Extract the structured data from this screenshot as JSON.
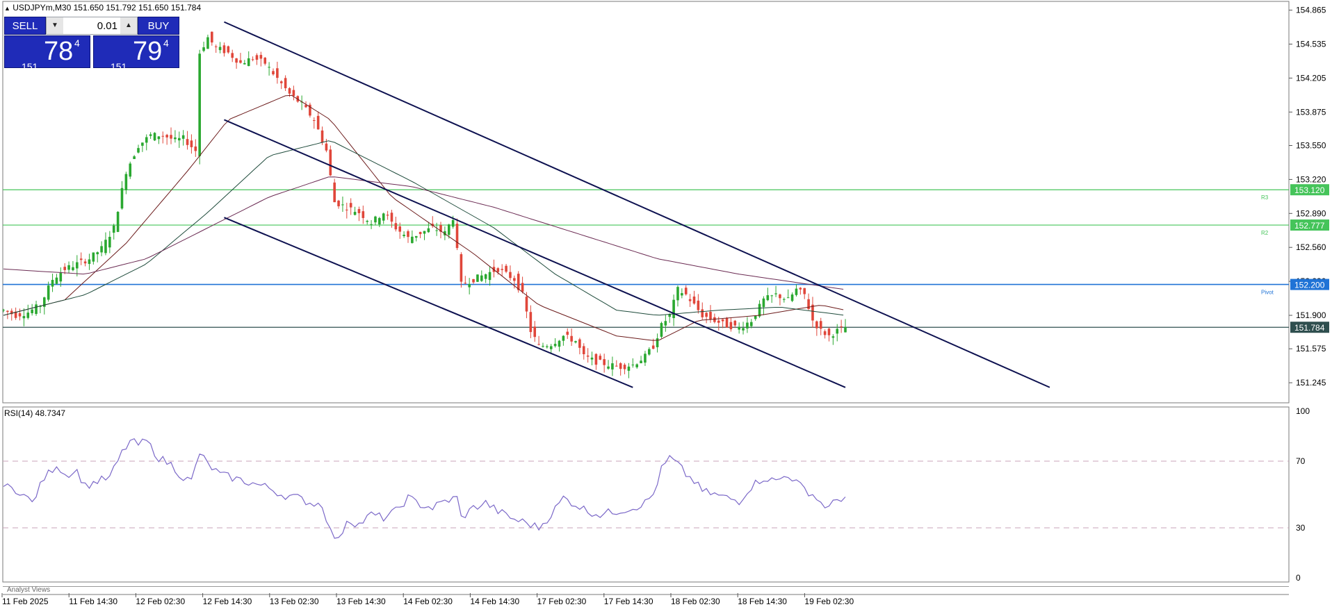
{
  "header": {
    "symbol_info": "USDJPYm,M30  151.650 151.792 151.650 151.784"
  },
  "trade_panel": {
    "sell_label": "SELL",
    "buy_label": "BUY",
    "lot": "0.01",
    "sell_price": {
      "big": "151",
      "main": "78",
      "sup": "4"
    },
    "buy_price": {
      "big": "151",
      "main": "79",
      "sup": "4"
    },
    "colors": {
      "button": "#1f2bb8"
    }
  },
  "bottom_tab": {
    "label": "Analyst Views"
  },
  "chart_data": [
    {
      "type": "candlestick",
      "title": "USDJPYm,M30",
      "ylim": [
        151.05,
        154.95
      ],
      "y_ticks": [
        "154.865",
        "154.535",
        "154.205",
        "153.875",
        "153.550",
        "153.220",
        "152.890",
        "152.560",
        "152.230",
        "151.900",
        "151.575",
        "151.245"
      ],
      "x_ticks": [
        "11 Feb 2025",
        "11 Feb 14:30",
        "12 Feb 02:30",
        "12 Feb 14:30",
        "13 Feb 02:30",
        "13 Feb 14:30",
        "14 Feb 02:30",
        "14 Feb 14:30",
        "17 Feb 02:30",
        "17 Feb 14:30",
        "18 Feb 02:30",
        "18 Feb 14:30",
        "19 Feb 02:30"
      ],
      "close_path": [
        [
          0,
          151.95
        ],
        [
          6,
          151.9
        ],
        [
          12,
          151.93
        ],
        [
          18,
          152.0
        ],
        [
          24,
          152.25
        ],
        [
          30,
          152.35
        ],
        [
          36,
          152.4
        ],
        [
          42,
          152.45
        ],
        [
          48,
          152.55
        ],
        [
          54,
          152.75
        ],
        [
          60,
          153.3
        ],
        [
          66,
          153.55
        ],
        [
          72,
          153.65
        ],
        [
          78,
          153.65
        ],
        [
          84,
          153.6
        ],
        [
          88,
          153.62
        ],
        [
          94,
          153.5
        ],
        [
          96,
          154.45
        ],
        [
          100,
          154.6
        ],
        [
          104,
          154.5
        ],
        [
          110,
          154.45
        ],
        [
          116,
          154.35
        ],
        [
          122,
          154.4
        ],
        [
          128,
          154.35
        ],
        [
          134,
          154.2
        ],
        [
          140,
          154.05
        ],
        [
          146,
          153.95
        ],
        [
          152,
          153.8
        ],
        [
          158,
          153.5
        ],
        [
          162,
          153.0
        ],
        [
          168,
          152.95
        ],
        [
          174,
          152.9
        ],
        [
          180,
          152.8
        ],
        [
          186,
          152.9
        ],
        [
          192,
          152.75
        ],
        [
          198,
          152.65
        ],
        [
          204,
          152.7
        ],
        [
          210,
          152.75
        ],
        [
          216,
          152.7
        ],
        [
          220,
          152.85
        ],
        [
          224,
          152.2
        ],
        [
          230,
          152.25
        ],
        [
          236,
          152.3
        ],
        [
          242,
          152.35
        ],
        [
          246,
          152.3
        ],
        [
          250,
          152.25
        ],
        [
          254,
          152.1
        ],
        [
          258,
          151.75
        ],
        [
          262,
          151.6
        ],
        [
          268,
          151.62
        ],
        [
          274,
          151.7
        ],
        [
          280,
          151.65
        ],
        [
          284,
          151.5
        ],
        [
          290,
          151.45
        ],
        [
          296,
          151.42
        ],
        [
          302,
          151.4
        ],
        [
          308,
          151.42
        ],
        [
          314,
          151.5
        ],
        [
          318,
          151.6
        ],
        [
          322,
          151.8
        ],
        [
          326,
          151.9
        ],
        [
          330,
          152.15
        ],
        [
          334,
          152.1
        ],
        [
          338,
          152.0
        ],
        [
          342,
          151.9
        ],
        [
          348,
          151.85
        ],
        [
          354,
          151.8
        ],
        [
          360,
          151.78
        ],
        [
          366,
          151.85
        ],
        [
          372,
          152.05
        ],
        [
          378,
          152.1
        ],
        [
          384,
          152.05
        ],
        [
          388,
          152.15
        ],
        [
          392,
          152.1
        ],
        [
          396,
          151.85
        ],
        [
          400,
          151.75
        ],
        [
          404,
          151.7
        ],
        [
          408,
          151.75
        ],
        [
          412,
          151.784
        ]
      ],
      "moving_averages": [
        {
          "color": "#6b1a1a",
          "points": [
            [
              0,
              151.9
            ],
            [
              30,
              152.05
            ],
            [
              60,
              152.6
            ],
            [
              90,
              153.3
            ],
            [
              110,
              153.8
            ],
            [
              140,
              154.05
            ],
            [
              160,
              153.8
            ],
            [
              190,
              153.05
            ],
            [
              230,
              152.5
            ],
            [
              262,
              152.0
            ],
            [
              300,
              151.7
            ],
            [
              320,
              151.65
            ],
            [
              340,
              151.85
            ],
            [
              370,
              151.9
            ],
            [
              400,
              152.0
            ],
            [
              412,
              151.95
            ]
          ]
        },
        {
          "color": "#1d4a3a",
          "points": [
            [
              0,
              151.9
            ],
            [
              40,
              152.1
            ],
            [
              70,
              152.4
            ],
            [
              100,
              152.9
            ],
            [
              130,
              153.45
            ],
            [
              160,
              153.6
            ],
            [
              200,
              153.2
            ],
            [
              240,
              152.75
            ],
            [
              270,
              152.3
            ],
            [
              300,
              151.95
            ],
            [
              320,
              151.9
            ],
            [
              350,
              151.95
            ],
            [
              380,
              151.98
            ],
            [
              412,
              151.9
            ]
          ]
        },
        {
          "color": "#6a2a52",
          "points": [
            [
              0,
              152.35
            ],
            [
              40,
              152.3
            ],
            [
              70,
              152.45
            ],
            [
              100,
              152.75
            ],
            [
              130,
              153.05
            ],
            [
              160,
              153.25
            ],
            [
              200,
              153.15
            ],
            [
              240,
              152.95
            ],
            [
              280,
              152.7
            ],
            [
              320,
              152.45
            ],
            [
              360,
              152.3
            ],
            [
              412,
              152.15
            ]
          ]
        }
      ],
      "channel_lines": [
        {
          "from": [
            108,
            154.75
          ],
          "to": [
            512,
            151.2
          ]
        },
        {
          "from": [
            108,
            153.8
          ],
          "to": [
            412,
            151.2
          ]
        },
        {
          "from": [
            108,
            152.85
          ],
          "to": [
            308,
            151.2
          ]
        }
      ],
      "levels": [
        {
          "value": 153.12,
          "label": "153.120",
          "tag": "R3",
          "color": "#45c45a"
        },
        {
          "value": 152.777,
          "label": "152.777",
          "tag": "R2",
          "color": "#45c45a"
        },
        {
          "value": 152.2,
          "label": "152.200",
          "tag": "Pivot",
          "color": "#1f73d6"
        },
        {
          "value": 151.784,
          "label": "151.784",
          "tag": "",
          "color": "#2f4f4f"
        }
      ],
      "colors": {
        "up": "#2aa830",
        "down": "#e0463a"
      }
    },
    {
      "type": "line",
      "title": "RSI(14) 48.7347",
      "ylim": [
        0,
        100
      ],
      "y_ticks": [
        "100",
        "70",
        "30",
        "0"
      ],
      "levels": [
        70,
        30
      ],
      "color": "#7b68c8",
      "points": [
        [
          0,
          55
        ],
        [
          8,
          52
        ],
        [
          14,
          45
        ],
        [
          20,
          60
        ],
        [
          26,
          68
        ],
        [
          30,
          62
        ],
        [
          36,
          64
        ],
        [
          40,
          55
        ],
        [
          46,
          58
        ],
        [
          52,
          60
        ],
        [
          58,
          75
        ],
        [
          62,
          82
        ],
        [
          66,
          80
        ],
        [
          70,
          82
        ],
        [
          76,
          72
        ],
        [
          82,
          68
        ],
        [
          88,
          60
        ],
        [
          92,
          58
        ],
        [
          96,
          75
        ],
        [
          100,
          68
        ],
        [
          106,
          62
        ],
        [
          112,
          60
        ],
        [
          118,
          58
        ],
        [
          124,
          56
        ],
        [
          130,
          54
        ],
        [
          136,
          50
        ],
        [
          144,
          48
        ],
        [
          150,
          45
        ],
        [
          156,
          44
        ],
        [
          160,
          28
        ],
        [
          164,
          22
        ],
        [
          168,
          35
        ],
        [
          174,
          32
        ],
        [
          180,
          38
        ],
        [
          186,
          36
        ],
        [
          192,
          40
        ],
        [
          198,
          48
        ],
        [
          204,
          44
        ],
        [
          210,
          42
        ],
        [
          216,
          46
        ],
        [
          222,
          48
        ],
        [
          224,
          36
        ],
        [
          230,
          42
        ],
        [
          236,
          45
        ],
        [
          242,
          40
        ],
        [
          250,
          35
        ],
        [
          256,
          33
        ],
        [
          262,
          30
        ],
        [
          268,
          38
        ],
        [
          274,
          48
        ],
        [
          280,
          44
        ],
        [
          286,
          40
        ],
        [
          292,
          38
        ],
        [
          300,
          40
        ],
        [
          308,
          42
        ],
        [
          314,
          45
        ],
        [
          318,
          50
        ],
        [
          322,
          65
        ],
        [
          326,
          72
        ],
        [
          330,
          68
        ],
        [
          334,
          62
        ],
        [
          338,
          58
        ],
        [
          342,
          52
        ],
        [
          348,
          50
        ],
        [
          354,
          48
        ],
        [
          360,
          46
        ],
        [
          366,
          55
        ],
        [
          372,
          60
        ],
        [
          378,
          58
        ],
        [
          384,
          62
        ],
        [
          390,
          55
        ],
        [
          396,
          50
        ],
        [
          400,
          45
        ],
        [
          404,
          42
        ],
        [
          408,
          47
        ],
        [
          412,
          48.7
        ]
      ]
    }
  ]
}
